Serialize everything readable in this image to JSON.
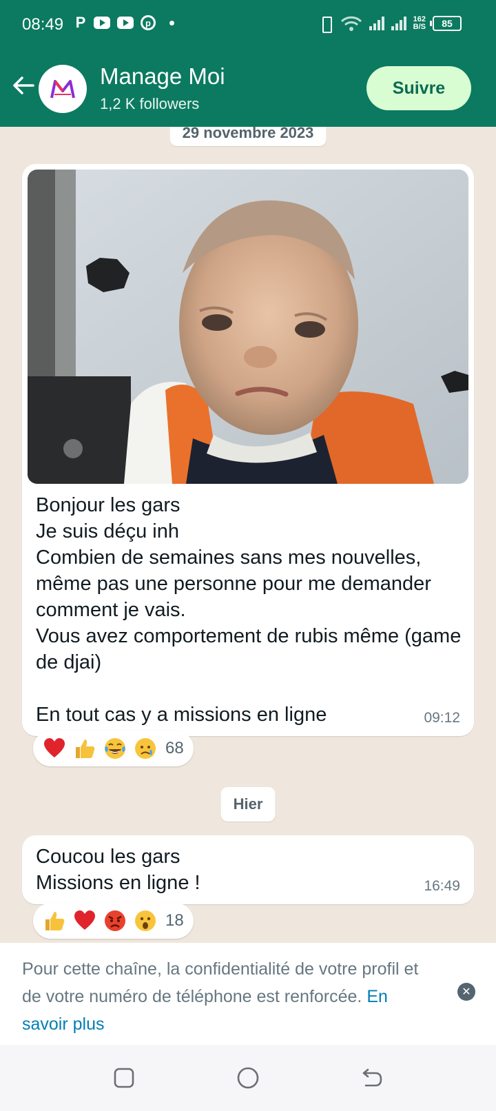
{
  "status_bar": {
    "time": "08:49",
    "speed_value": "162",
    "speed_unit": "B/S",
    "battery": "85",
    "app_icons": [
      "p-app-icon",
      "youtube-icon",
      "youtube-icon",
      "pinterest-icon"
    ]
  },
  "header": {
    "channel_name": "Manage Moi",
    "followers": "1,2 K followers",
    "follow_label": "Suivre",
    "theme_color": "#0b7a60"
  },
  "chat": {
    "date_separator_1": "29 novembre 2023",
    "date_separator_2": "Hier",
    "messages": [
      {
        "has_image": true,
        "text": "Bonjour les gars\nJe suis déçu inh\nCombien de semaines sans mes nouvelles, même pas une personne pour me demander comment je vais.\nVous avez comportement de rubis même (game de djai)\n\nEn tout cas y a missions en ligne",
        "time": "09:12",
        "reactions": [
          "red-heart-emoji",
          "thumbs-up-emoji",
          "tears-of-joy-emoji",
          "sad-emoji"
        ],
        "reaction_count": "68"
      },
      {
        "has_image": false,
        "text": "Coucou les gars\nMissions en ligne !",
        "time": "16:49",
        "reactions": [
          "thumbs-up-emoji",
          "red-heart-emoji",
          "angry-emoji",
          "surprised-emoji"
        ],
        "reaction_count": "18"
      }
    ]
  },
  "privacy_banner": {
    "text": "Pour cette chaîne, la confidentialité de votre profil et de votre numéro de téléphone est renforcée. ",
    "link": "En savoir plus"
  }
}
